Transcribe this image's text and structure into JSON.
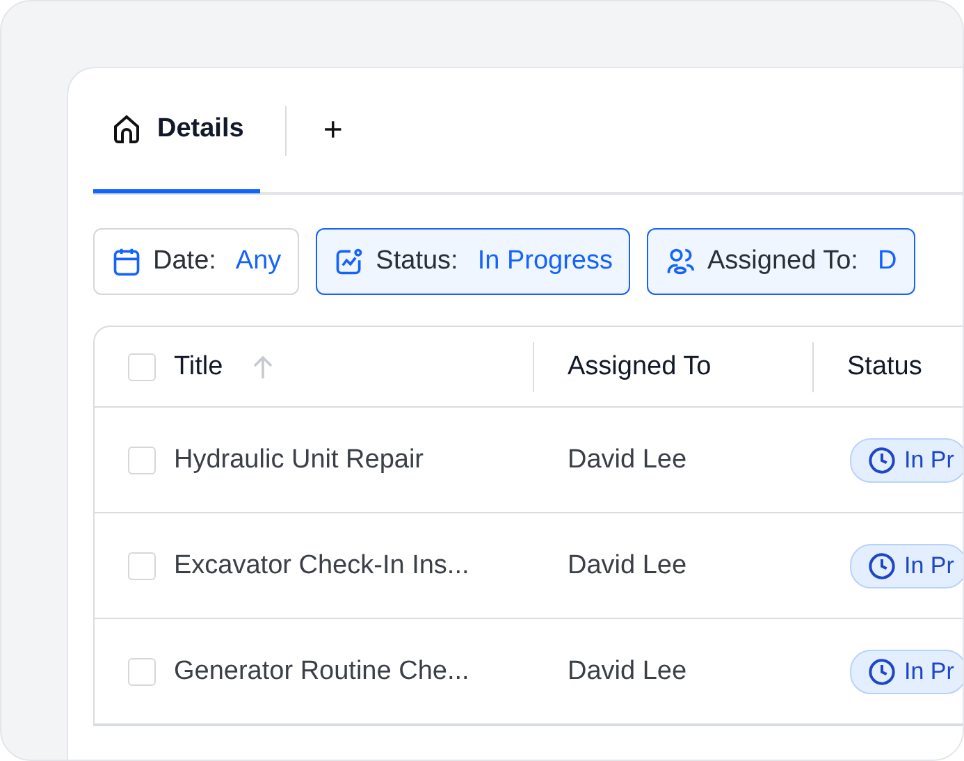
{
  "tabs": [
    {
      "label": "Details",
      "selected": true
    }
  ],
  "add_tab": "+",
  "filters": [
    {
      "label": "Date:",
      "value": "Any",
      "kind": "date",
      "active": false
    },
    {
      "label": "Status:",
      "value": "In Progress",
      "kind": "status",
      "active": true
    },
    {
      "label": "Assigned To:",
      "value": "D",
      "kind": "people",
      "active": true
    }
  ],
  "table": {
    "columns": [
      {
        "label": "Title",
        "sorted": true
      },
      {
        "label": "Assigned To",
        "sorted": false
      },
      {
        "label": "Status",
        "sorted": false
      }
    ],
    "header_checked": false,
    "rows": [
      {
        "title": "Hydraulic Unit Repair",
        "assigned_to": "David Lee",
        "status": "In Pr",
        "checked": false
      },
      {
        "title": "Excavator Check-In Ins...",
        "assigned_to": "David Lee",
        "status": "In Pr",
        "checked": false
      },
      {
        "title": "Generator Routine Che...",
        "assigned_to": "David Lee",
        "status": "In Pr",
        "checked": false
      }
    ]
  }
}
